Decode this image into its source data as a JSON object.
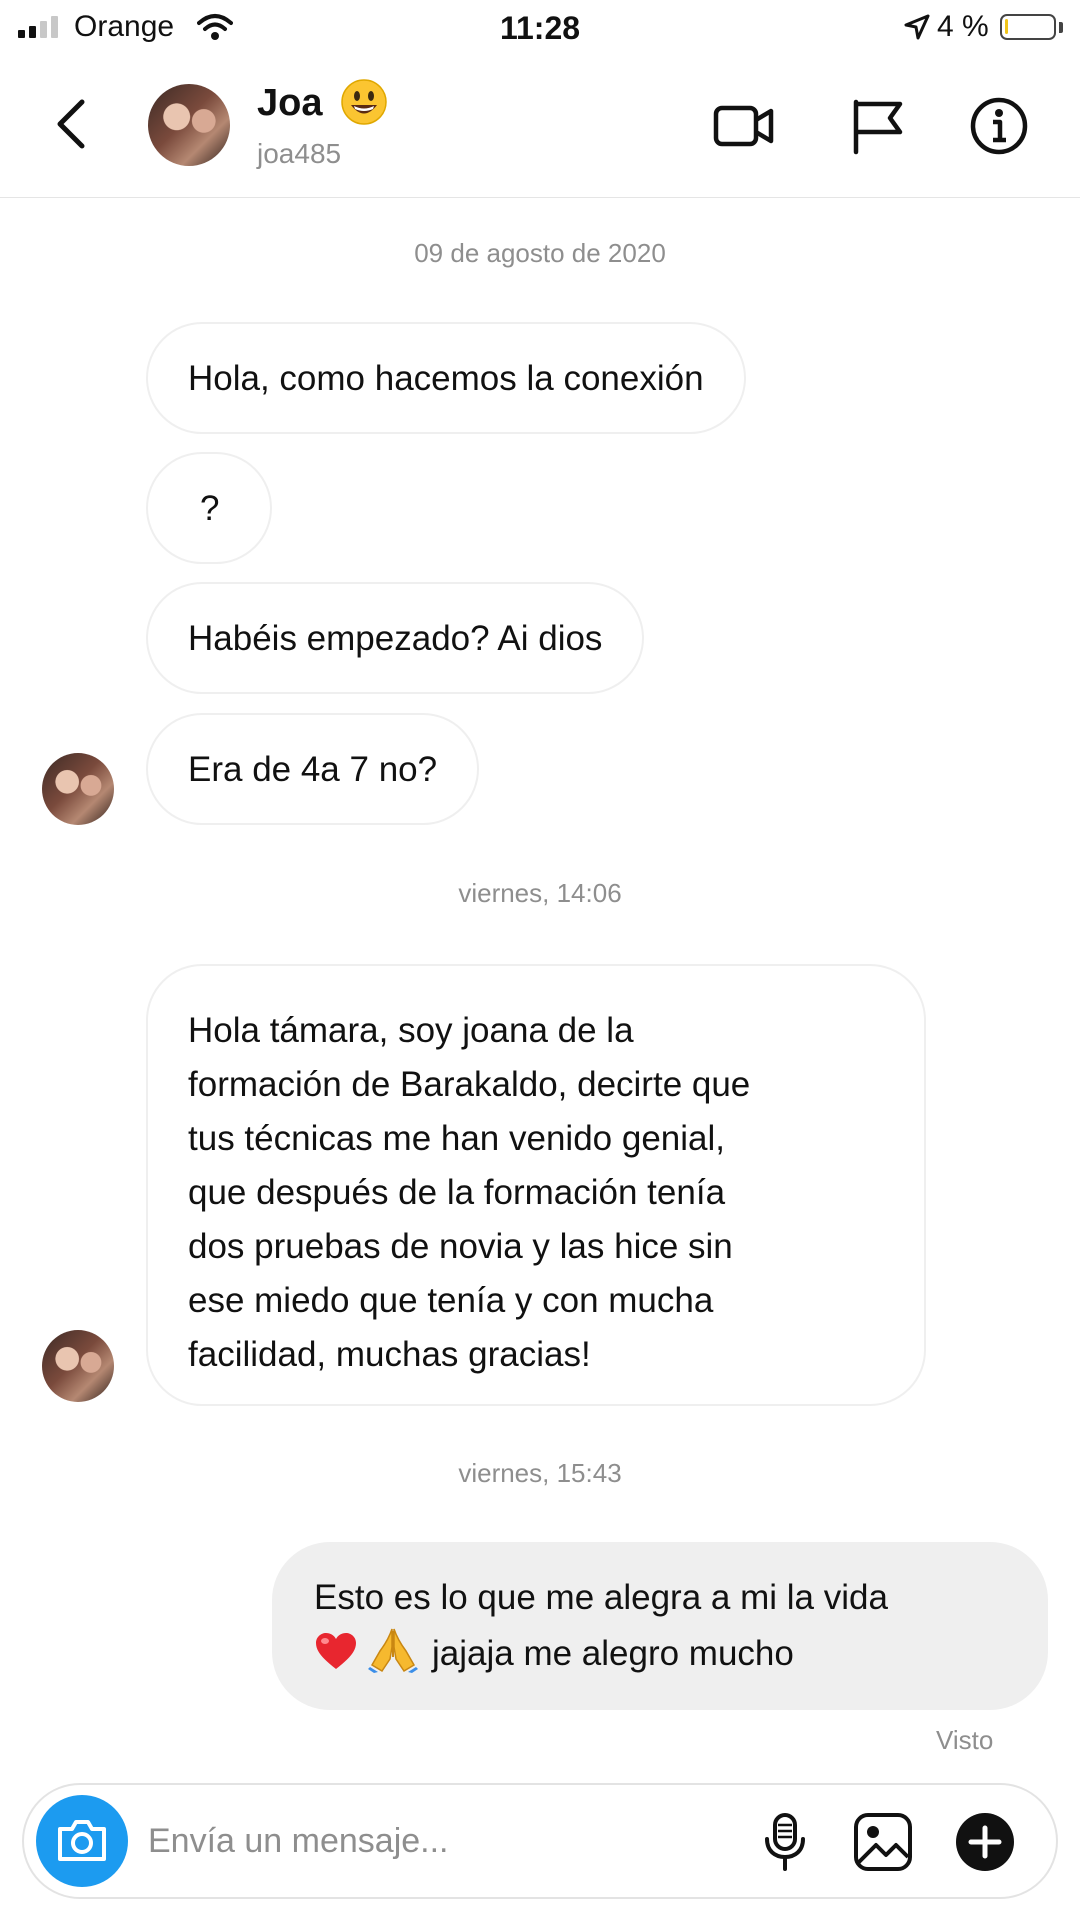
{
  "status_bar": {
    "carrier": "Orange",
    "time": "11:28",
    "battery_percent": "4 %",
    "battery_level": 0.04,
    "signal_bars_active": 2,
    "icons": [
      "signal-icon",
      "wifi-icon",
      "location-arrow-icon",
      "battery-icon"
    ]
  },
  "header": {
    "name": "Joa",
    "name_emoji": "smiling-face-emoji",
    "username": "joa485",
    "icons": [
      "back-chevron-icon",
      "video-call-icon",
      "flag-icon",
      "info-icon"
    ]
  },
  "conversation": {
    "separators": [
      "09 de agosto de 2020",
      "viernes, 14:06",
      "viernes, 15:43"
    ],
    "incoming": [
      "Hola, como hacemos la conexión",
      "?",
      "Habéis empezado? Ai dios",
      "Era de 4a 7 no?"
    ],
    "incoming_long_lines": [
      "Hola támara, soy joana de la",
      "formación de Barakaldo, decirte que",
      "tus técnicas me han venido genial,",
      "que después de la formación tenía",
      "dos pruebas de novia y las hice sin",
      "ese miedo que tenía y con mucha",
      "facilidad, muchas gracias!"
    ],
    "outgoing_line1": "Esto es lo que me alegra a mi la vida",
    "outgoing_line2_text": "jajaja me alegro mucho",
    "outgoing_emojis": [
      "red-heart-emoji",
      "folded-hands-emoji"
    ],
    "seen_label": "Visto"
  },
  "composer": {
    "placeholder": "Envía un mensaje...",
    "value": "",
    "icons": [
      "camera-icon",
      "microphone-icon",
      "gallery-icon",
      "add-plus-icon"
    ]
  },
  "colors": {
    "accent_blue": "#1c9bf0",
    "outgoing_bubble": "#efefef",
    "muted_text": "#8e8e8e",
    "battery_low": "#f0c419"
  }
}
